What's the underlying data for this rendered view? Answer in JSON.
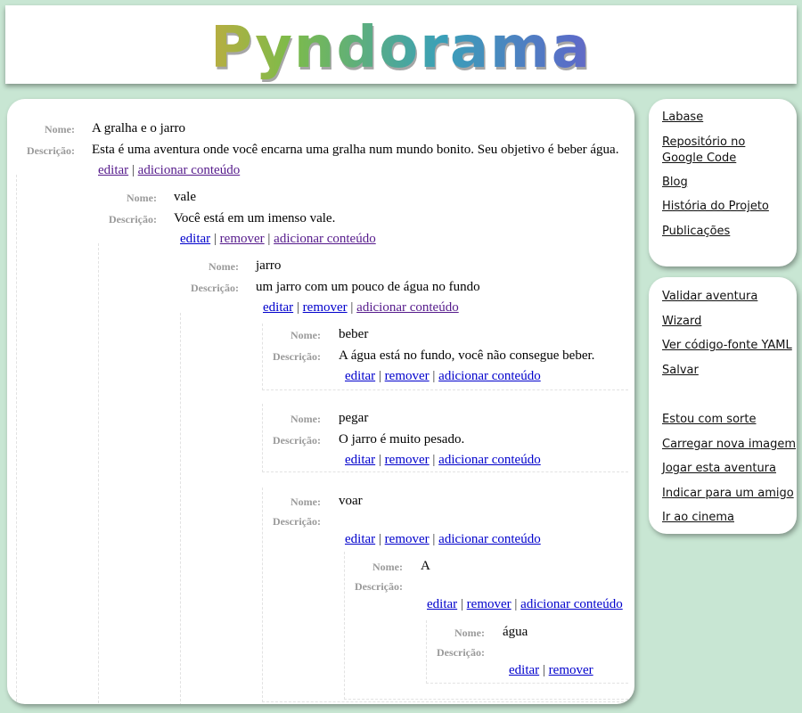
{
  "header": {
    "logo_text": "Pyndorama"
  },
  "labels": {
    "name": "Nome:",
    "description": "Descrição:"
  },
  "actions": {
    "edit": "editar",
    "remove": "remover",
    "add": "adicionar conteúdo",
    "sep": "|"
  },
  "tree": {
    "root": {
      "name": "A gralha e o jarro",
      "description": "Esta é uma aventura onde você encarna uma gralha num mundo bonito. Seu objetivo é beber água."
    },
    "vale": {
      "name": "vale",
      "description": "Você está em um imenso vale."
    },
    "jarro": {
      "name": "jarro",
      "description": "um jarro com um pouco de água no fundo"
    },
    "beber": {
      "name": "beber",
      "description": "A água está no fundo, você não consegue beber."
    },
    "pegar": {
      "name": "pegar",
      "description": "O jarro é muito pesado."
    },
    "voar": {
      "name": "voar",
      "description": ""
    },
    "a": {
      "name": "A",
      "description": ""
    },
    "agua": {
      "name": "água",
      "description": ""
    }
  },
  "sidebar": {
    "links": [
      "Labase",
      "Repositório no Google Code",
      "Blog",
      "História do Projeto",
      "Publicações"
    ],
    "tools": [
      "Validar aventura",
      "Wizard",
      "Ver código-fonte YAML",
      "Salvar"
    ],
    "extras": [
      "Estou com sorte",
      "Carregar nova imagem",
      "Jogar esta aventura",
      "Indicar para um amigo",
      "Ir ao cinema"
    ]
  }
}
